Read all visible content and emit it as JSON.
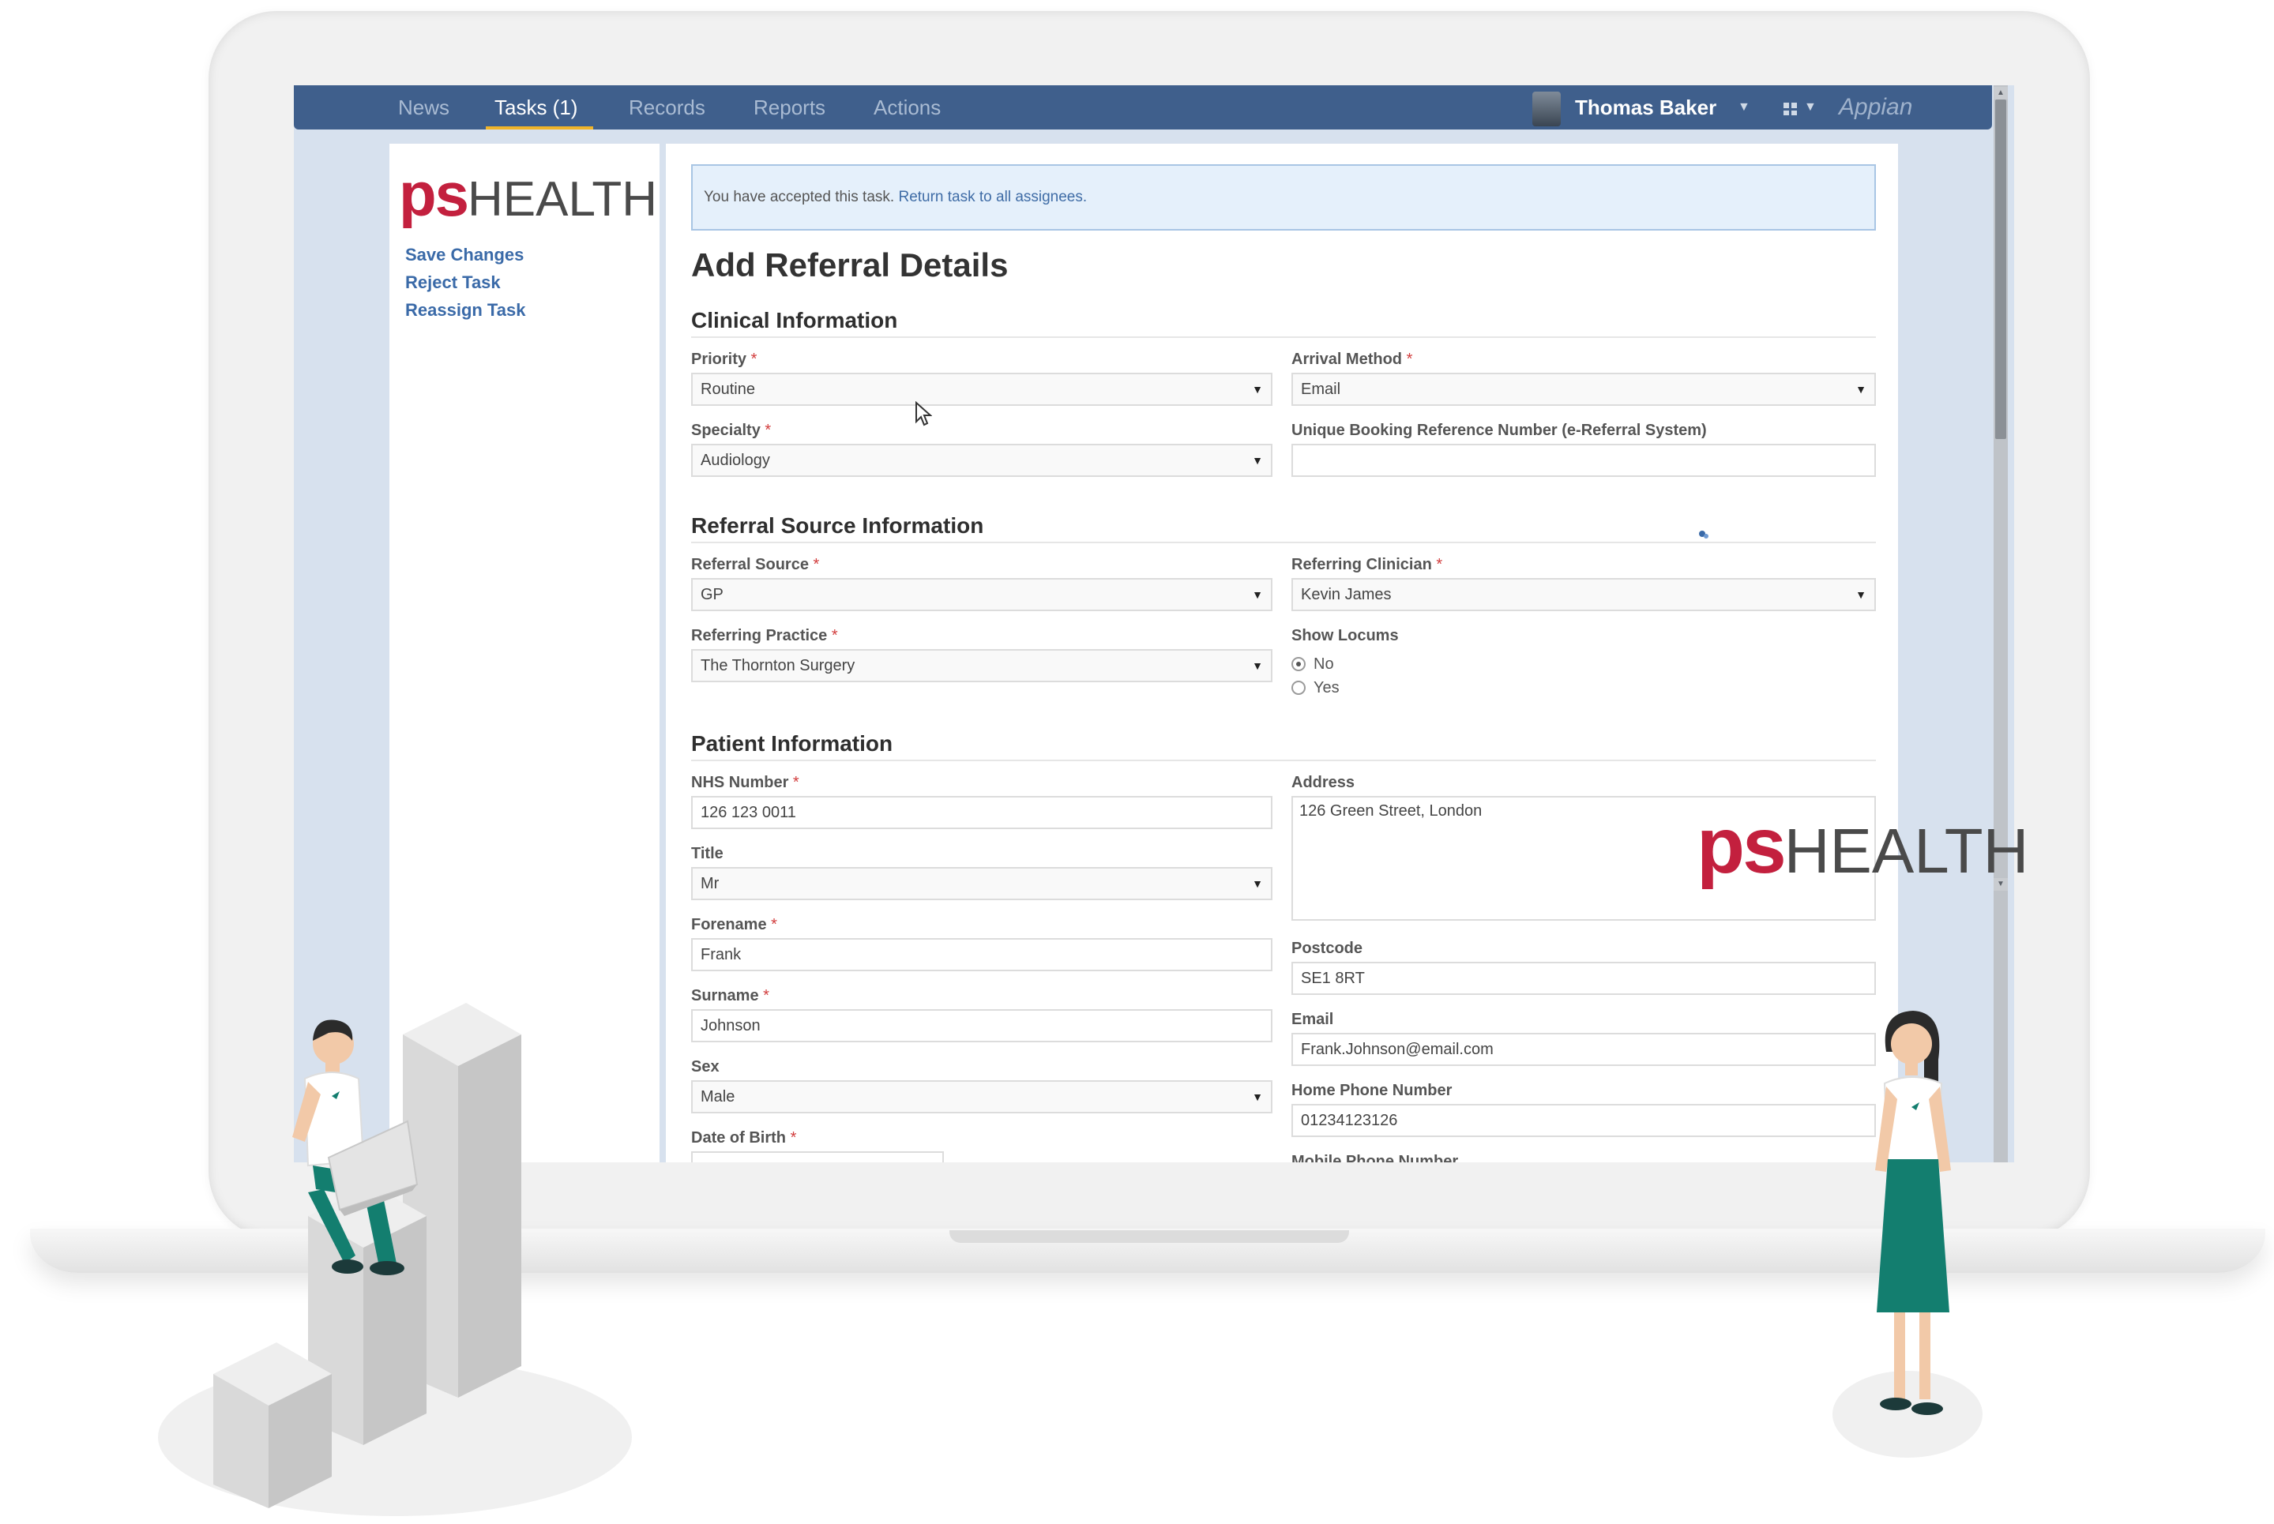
{
  "nav": {
    "items": [
      {
        "label": "News",
        "active": false
      },
      {
        "label": "Tasks (1)",
        "active": true
      },
      {
        "label": "Records",
        "active": false
      },
      {
        "label": "Reports",
        "active": false
      },
      {
        "label": "Actions",
        "active": false
      }
    ],
    "user_name": "Thomas Baker",
    "brand": "Appian",
    "icons": {
      "user_menu": "chevron-down-icon",
      "apps_menu": "apps-grid-icon"
    }
  },
  "sidebar": {
    "logo_ps": "ps",
    "logo_health": "HEALTH",
    "links": [
      "Save Changes",
      "Reject Task",
      "Reassign Task"
    ]
  },
  "notice": {
    "text": "You have accepted this task.",
    "link": "Return task to all assignees."
  },
  "form": {
    "title": "Add Referral Details",
    "sections": {
      "clinical": "Clinical Information",
      "referral": "Referral Source Information",
      "patient": "Patient Information"
    },
    "required_mark": "*",
    "fields": {
      "priority": {
        "label": "Priority",
        "value": "Routine"
      },
      "arrival_method": {
        "label": "Arrival Method",
        "value": "Email"
      },
      "specialty": {
        "label": "Specialty",
        "value": "Audiology"
      },
      "ubrn": {
        "label": "Unique Booking Reference Number (e-Referral System)",
        "value": ""
      },
      "referral_source": {
        "label": "Referral Source",
        "value": "GP"
      },
      "referring_clinician": {
        "label": "Referring Clinician",
        "value": "Kevin James"
      },
      "referring_practice": {
        "label": "Referring Practice",
        "value": "The Thornton Surgery"
      },
      "show_locums": {
        "label": "Show Locums",
        "options": [
          "No",
          "Yes"
        ],
        "selected": "No"
      },
      "nhs_number": {
        "label": "NHS Number",
        "value": "126 123 0011"
      },
      "address": {
        "label": "Address",
        "value": "126 Green Street, London"
      },
      "title": {
        "label": "Title",
        "value": "Mr"
      },
      "forename": {
        "label": "Forename",
        "value": "Frank"
      },
      "postcode": {
        "label": "Postcode",
        "value": "SE1 8RT"
      },
      "surname": {
        "label": "Surname",
        "value": "Johnson"
      },
      "email": {
        "label": "Email",
        "value": "Frank.Johnson@email.com"
      },
      "sex": {
        "label": "Sex",
        "value": "Male"
      },
      "home_phone": {
        "label": "Home Phone Number",
        "value": "01234123126"
      },
      "dob": {
        "label": "Date of Birth"
      },
      "mobile_phone": {
        "label": "Mobile Phone Number"
      }
    }
  },
  "watermark": {
    "ps": "ps",
    "health": "HEALTH"
  },
  "colors": {
    "brand_red": "#c3203e",
    "nav_blue": "#3f5f8c",
    "accent_gold": "#f0b429",
    "figure_green": "#137e6f"
  }
}
